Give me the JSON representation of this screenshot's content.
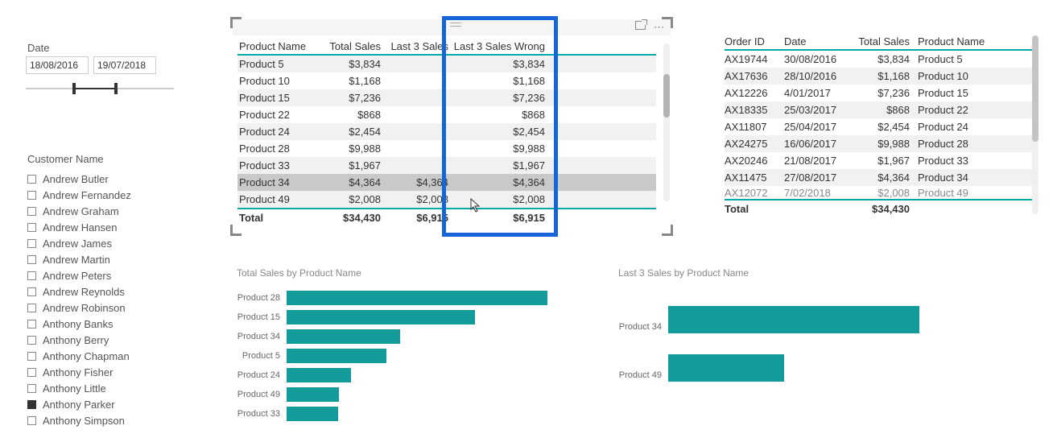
{
  "date_slicer": {
    "label": "Date",
    "from": "18/08/2016",
    "to": "19/07/2018"
  },
  "customer_slicer": {
    "label": "Customer Name",
    "items": [
      {
        "name": "Andrew Butler",
        "checked": false
      },
      {
        "name": "Andrew Fernandez",
        "checked": false
      },
      {
        "name": "Andrew Graham",
        "checked": false
      },
      {
        "name": "Andrew Hansen",
        "checked": false
      },
      {
        "name": "Andrew James",
        "checked": false
      },
      {
        "name": "Andrew Martin",
        "checked": false
      },
      {
        "name": "Andrew Peters",
        "checked": false
      },
      {
        "name": "Andrew Reynolds",
        "checked": false
      },
      {
        "name": "Andrew Robinson",
        "checked": false
      },
      {
        "name": "Anthony Banks",
        "checked": false
      },
      {
        "name": "Anthony Berry",
        "checked": false
      },
      {
        "name": "Anthony Chapman",
        "checked": false
      },
      {
        "name": "Anthony Fisher",
        "checked": false
      },
      {
        "name": "Anthony Little",
        "checked": false
      },
      {
        "name": "Anthony Parker",
        "checked": true
      },
      {
        "name": "Anthony Simpson",
        "checked": false
      }
    ]
  },
  "table1": {
    "headers": {
      "product": "Product Name",
      "total": "Total Sales",
      "last3": "Last 3 Sales",
      "last3w": "Last 3 Sales Wrong"
    },
    "rows": [
      {
        "product": "Product 5",
        "total": "$3,834",
        "last3": "",
        "last3w": "$3,834"
      },
      {
        "product": "Product 10",
        "total": "$1,168",
        "last3": "",
        "last3w": "$1,168"
      },
      {
        "product": "Product 15",
        "total": "$7,236",
        "last3": "",
        "last3w": "$7,236"
      },
      {
        "product": "Product 22",
        "total": "$868",
        "last3": "",
        "last3w": "$868"
      },
      {
        "product": "Product 24",
        "total": "$2,454",
        "last3": "",
        "last3w": "$2,454"
      },
      {
        "product": "Product 28",
        "total": "$9,988",
        "last3": "",
        "last3w": "$9,988"
      },
      {
        "product": "Product 33",
        "total": "$1,967",
        "last3": "",
        "last3w": "$1,967"
      },
      {
        "product": "Product 34",
        "total": "$4,364",
        "last3": "$4,364",
        "last3w": "$4,364"
      },
      {
        "product": "Product 49",
        "total": "$2,008",
        "last3": "$2,008",
        "last3w": "$2,008"
      }
    ],
    "total": {
      "label": "Total",
      "total": "$34,430",
      "last3": "$6,915",
      "last3w": "$6,915"
    }
  },
  "table2": {
    "headers": {
      "oid": "Order ID",
      "date": "Date",
      "total": "Total Sales",
      "product": "Product Name"
    },
    "rows": [
      {
        "oid": "AX19744",
        "date": "30/08/2016",
        "total": "$3,834",
        "product": "Product 5"
      },
      {
        "oid": "AX17636",
        "date": "28/10/2016",
        "total": "$1,168",
        "product": "Product 10"
      },
      {
        "oid": "AX12226",
        "date": "4/01/2017",
        "total": "$7,236",
        "product": "Product 15"
      },
      {
        "oid": "AX18335",
        "date": "25/03/2017",
        "total": "$868",
        "product": "Product 22"
      },
      {
        "oid": "AX11807",
        "date": "25/04/2017",
        "total": "$2,454",
        "product": "Product 24"
      },
      {
        "oid": "AX24275",
        "date": "16/06/2017",
        "total": "$9,988",
        "product": "Product 28"
      },
      {
        "oid": "AX20246",
        "date": "21/08/2017",
        "total": "$1,967",
        "product": "Product 33"
      },
      {
        "oid": "AX11475",
        "date": "27/08/2017",
        "total": "$4,364",
        "product": "Product 34"
      },
      {
        "oid": "AX12072",
        "date": "7/02/2018",
        "total": "$2,008",
        "product": "Product 49"
      }
    ],
    "total": {
      "label": "Total",
      "total": "$34,430"
    }
  },
  "chart1_title": "Total Sales by Product Name",
  "chart2_title": "Last 3 Sales by Product Name",
  "chart_data": [
    {
      "type": "bar",
      "title": "Total Sales by Product Name",
      "xlabel": "",
      "ylabel": "",
      "categories": [
        "Product 28",
        "Product 15",
        "Product 34",
        "Product 5",
        "Product 24",
        "Product 49",
        "Product 33"
      ],
      "values": [
        9988,
        7236,
        4364,
        3834,
        2454,
        2008,
        1967
      ],
      "xlim": [
        0,
        10000
      ]
    },
    {
      "type": "bar",
      "title": "Last 3 Sales by Product Name",
      "xlabel": "",
      "ylabel": "",
      "categories": [
        "Product 34",
        "Product 49"
      ],
      "values": [
        4364,
        2008
      ],
      "xlim": [
        0,
        5000
      ]
    }
  ],
  "colors": {
    "accent": "#139b9b",
    "highlight_border": "#1565d8"
  }
}
